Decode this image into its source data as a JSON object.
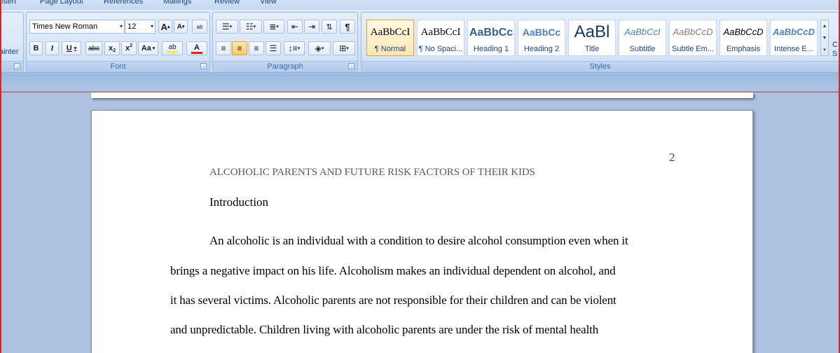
{
  "tabs": [
    "nsert",
    "Page Layout",
    "References",
    "Mailings",
    "Review",
    "View"
  ],
  "clipboard": {
    "painter_label": "ainter"
  },
  "font": {
    "group_label": "Font",
    "name": "Times New Roman",
    "size": "12",
    "grow_label": "A",
    "shrink_label": "A",
    "clear_label": "ab",
    "bold": "B",
    "italic": "I",
    "underline": "U",
    "strike": "abc",
    "subscript": "x",
    "superscript": "x",
    "change_case": "Aa",
    "highlight": "ab",
    "color": "A"
  },
  "paragraph": {
    "group_label": "Paragraph"
  },
  "styles": {
    "group_label": "Styles",
    "items": [
      {
        "sample": "AaBbCcI",
        "name": "¶ Normal"
      },
      {
        "sample": "AaBbCcI",
        "name": "¶ No Spaci..."
      },
      {
        "sample": "AaBbCc",
        "name": "Heading 1"
      },
      {
        "sample": "AaBbCc",
        "name": "Heading 2"
      },
      {
        "sample": "AaBl",
        "name": "Title"
      },
      {
        "sample": "AaBbCcI",
        "name": "Subtitle"
      },
      {
        "sample": "AaBbCcD",
        "name": "Subtle Em..."
      },
      {
        "sample": "AaBbCcD",
        "name": "Emphasis"
      },
      {
        "sample": "AaBbCcD",
        "name": "Intense E..."
      }
    ],
    "change_label_1": "C",
    "change_label_2": "S"
  },
  "document": {
    "page_number": "2",
    "running_head": "ALCOHOLIC PARENTS AND FUTURE RISK FACTORS OF THEIR KIDS",
    "heading": "Introduction",
    "lines": [
      "An alcoholic is an individual with a condition to desire alcohol consumption even when it",
      "brings a negative impact on his life.  Alcoholism makes an individual dependent on alcohol, and",
      "it has several victims. Alcoholic parents are  not responsible for their children and can be violent",
      "and unpredictable. Children living with alcoholic parents are under the risk  of mental health"
    ]
  },
  "colors": {
    "ribbon": "#d3e3f6",
    "workspace": "#abc3e0",
    "selected_style": "#f8c66b",
    "font_color_bar": "#e8201d",
    "highlight_bar": "#f3e84d",
    "window_edge": "#d22a2a"
  }
}
